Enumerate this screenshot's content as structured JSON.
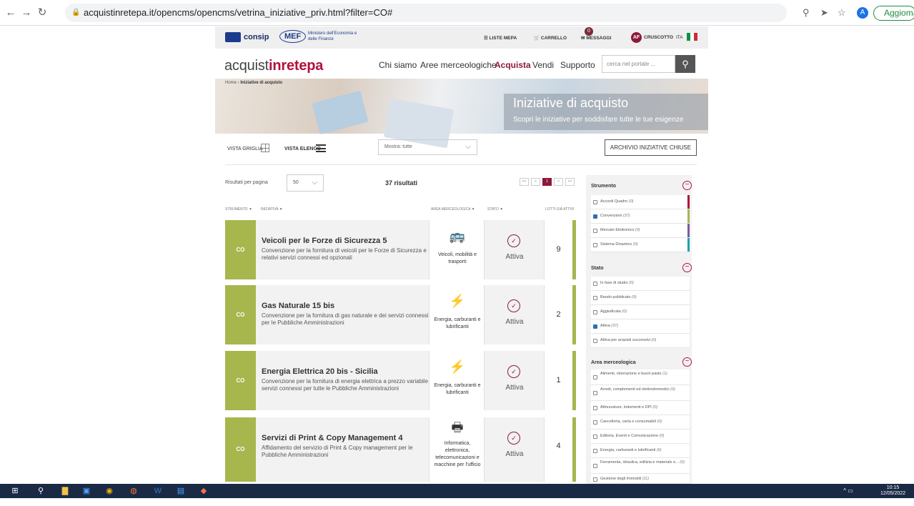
{
  "browser": {
    "url": "acquistinretepa.it/opencms/opencms/vetrina_iniziative_priv.html?filter=CO#",
    "update_label": "Aggioma",
    "profile_initial": "A"
  },
  "topbar": {
    "consip": "consip",
    "mef": "MEF",
    "mef_sub": "Ministero dell'Economia e delle Finanze",
    "liste": "LISTE MEPA",
    "carrello": "CARRELLO",
    "messaggi": "MESSAGGI",
    "messaggi_count": "0",
    "user_initials": "AF",
    "cruscotto": "CRUSCOTTO",
    "lang": "ITA"
  },
  "logo": {
    "part1": "acquist",
    "part2": "inrete",
    "part3": "pa"
  },
  "nav": [
    "Chi siamo",
    "Aree merceologiche",
    "Acquista",
    "Vendi",
    "Supporto"
  ],
  "search": {
    "placeholder": "cerca nel portale ..."
  },
  "breadcrumb": {
    "home": "Home",
    "current": "Iniziative di acquisto"
  },
  "hero": {
    "title": "Iniziative di acquisto",
    "subtitle": "Scopri le iniziative per soddisfare tutte le tue esigenze"
  },
  "toolbar": {
    "vista_griglia": "VISTA GRIGLIA",
    "vista_elenco": "VISTA ELENCO",
    "mostra": "Mostra: tutte",
    "archivio": "ARCHIVIO INIZIATIVE CHIUSE",
    "per_pagina_label": "Risultati per pagina",
    "per_pagina_value": "50",
    "count": "37 risultati"
  },
  "pager": {
    "first": "<<",
    "prev": "<",
    "current": "1",
    "next": ">",
    "last": ">>"
  },
  "columns": {
    "strumento": "STRUMENTO ▼",
    "iniziativa": "INIZIATIVA ▼",
    "area": "AREA MERCEOLOGICA ▼",
    "stato": "STATO ▼",
    "lotti": "LOTTI GIÀ ATTIVI"
  },
  "rows": [
    {
      "strumento": "CO",
      "title": "Veicoli per le Forze di Sicurezza 5",
      "desc": "Convenzione per la fornitura di veicoli per le Forze di Sicurezza e relativi servizi connessi ed opzionali",
      "area": "Veicoli, mobilità e trasporti",
      "area_icon": "bus-icon",
      "stato": "Attiva",
      "lotti": "9"
    },
    {
      "strumento": "CO",
      "title": "Gas Naturale 15 bis",
      "desc": "Convenzione per la fornitura di gas naturale e dei servizi connessi per le Pubbliche Amministrazioni",
      "area": "Energia, carburanti e lubrificanti",
      "area_icon": "pylon-icon",
      "stato": "Attiva",
      "lotti": "2"
    },
    {
      "strumento": "CO",
      "title": "Energia Elettrica 20 bis - Sicilia",
      "desc": "Convenzione per la fornitura di energia elettrica a prezzo variabile e servizi connessi per tutte le Pubbliche Amministrazioni",
      "area": "Energia, carburanti e lubrificanti",
      "area_icon": "pylon-icon",
      "stato": "Attiva",
      "lotti": "1"
    },
    {
      "strumento": "CO",
      "title": "Servizi di Print & Copy Management 4",
      "desc": "Affidamento del servizio di Print & Copy management per le Pubbliche Amministrazioni",
      "area": "Informatica, elettronica, telecomunicazioni e macchine per l'ufficio",
      "area_icon": "printer-icon",
      "stato": "Attiva",
      "lotti": "4"
    }
  ],
  "filters": {
    "strumento": {
      "title": "Strumento",
      "items": [
        {
          "label": "Accordi Quadro",
          "count": "(0)",
          "checked": false,
          "color": "#b3103a"
        },
        {
          "label": "Convenzioni",
          "count": "(37)",
          "checked": true,
          "color": "#a7b64d"
        },
        {
          "label": "Mercato Elettronico",
          "count": "(0)",
          "checked": false,
          "color": "#7b5aa6"
        },
        {
          "label": "Sistema Dinamico",
          "count": "(0)",
          "checked": false,
          "color": "#1aa3a8"
        }
      ]
    },
    "stato": {
      "title": "Stato",
      "items": [
        {
          "label": "In fase di studio",
          "count": "(0)",
          "checked": false
        },
        {
          "label": "Bando pubblicato",
          "count": "(0)",
          "checked": false
        },
        {
          "label": "Aggiudicata",
          "count": "(0)",
          "checked": false
        },
        {
          "label": "Attiva",
          "count": "(37)",
          "checked": true
        },
        {
          "label": "Attiva per acquisti successivi",
          "count": "(0)",
          "checked": false
        }
      ]
    },
    "area": {
      "title": "Area merceologica",
      "items": [
        {
          "label": "Alimenti, ristorazione e buoni pasto",
          "count": "(1)",
          "checked": false
        },
        {
          "label": "Arredi, complementi ed elettrodomestici",
          "count": "(0)",
          "checked": false
        },
        {
          "label": "Attrezzature, indumenti e DPI",
          "count": "(0)",
          "checked": false
        },
        {
          "label": "Cancelleria, carta e consumabili",
          "count": "(0)",
          "checked": false
        },
        {
          "label": "Editoria, Eventi e Comunicazione",
          "count": "(0)",
          "checked": false
        },
        {
          "label": "Energia, carburanti e lubrificanti",
          "count": "(6)",
          "checked": false
        },
        {
          "label": "Ferramenta, idraulica, edilizia e materiale e...",
          "count": "(0)",
          "checked": false
        },
        {
          "label": "Gestione degli Immobili",
          "count": "(11)",
          "checked": false
        }
      ]
    }
  },
  "taskbar": {
    "time": "10:15",
    "date": "12/05/2022"
  },
  "colors": {
    "brand": "#b3103a",
    "convenzioni": "#a7b64d",
    "accent": "#8b1a3b"
  }
}
